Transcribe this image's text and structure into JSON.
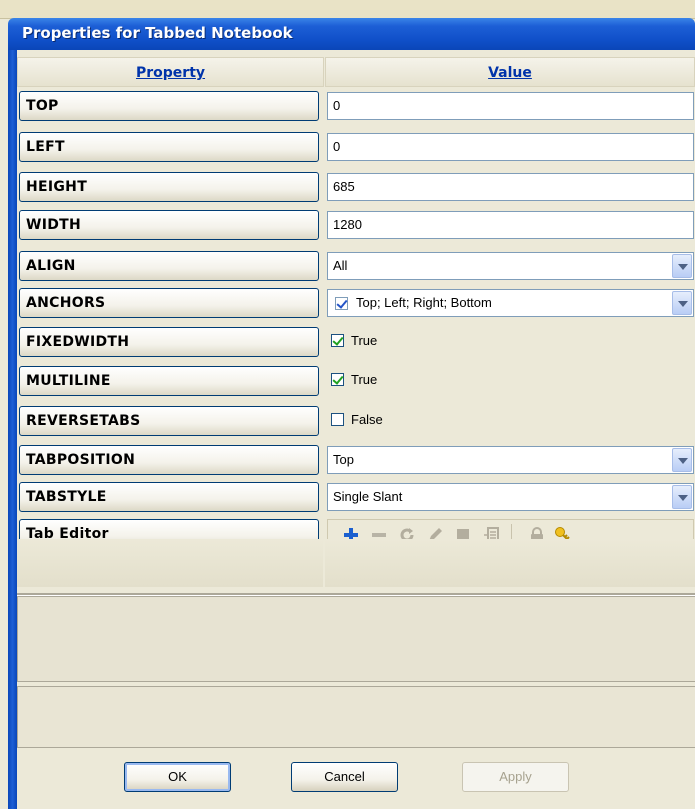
{
  "window": {
    "title": "Properties for Tabbed Notebook"
  },
  "headers": {
    "property": "Property",
    "value": "Value"
  },
  "rows": [
    {
      "name": "TOP",
      "value": "0"
    },
    {
      "name": "LEFT",
      "value": "0"
    },
    {
      "name": "HEIGHT",
      "value": "685"
    },
    {
      "name": "WIDTH",
      "value": "1280"
    },
    {
      "name": "ALIGN",
      "value": "All"
    },
    {
      "name": "ANCHORS",
      "value": "Top; Left; Right; Bottom"
    },
    {
      "name": "FIXEDWIDTH",
      "value": "True"
    },
    {
      "name": "MULTILINE",
      "value": "True"
    },
    {
      "name": "REVERSETABS",
      "value": "False"
    },
    {
      "name": "TABPOSITION",
      "value": "Top"
    },
    {
      "name": "TABSTYLE",
      "value": "Single Slant"
    },
    {
      "name": "Tab Editor",
      "value": ""
    }
  ],
  "toolbar_icons": [
    "add-icon",
    "remove-icon",
    "refresh-icon",
    "edit-icon",
    "bookmark-icon",
    "list-icon",
    "lock-icon",
    "key-icon"
  ],
  "buttons": {
    "ok": "OK",
    "cancel": "Cancel",
    "apply": "Apply"
  }
}
